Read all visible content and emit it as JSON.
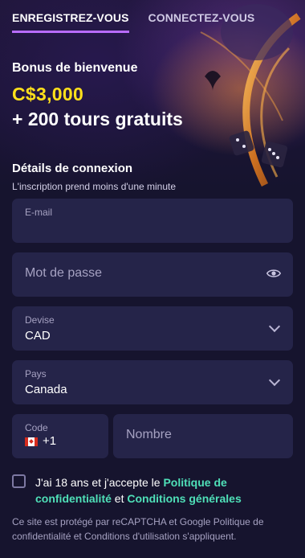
{
  "tabs": {
    "register": "ENREGISTREZ-VOUS",
    "login": "CONNECTEZ-VOUS"
  },
  "bonus": {
    "label": "Bonus de bienvenue",
    "amount": "C$3,000",
    "spins": "+ 200 tours gratuits"
  },
  "section": {
    "title": "Détails de connexion",
    "subtitle": "L'inscription prend moins d'une minute"
  },
  "form": {
    "email": {
      "label": "E-mail",
      "value": ""
    },
    "password": {
      "placeholder": "Mot de passe"
    },
    "currency": {
      "label": "Devise",
      "value": "CAD"
    },
    "country": {
      "label": "Pays",
      "value": "Canada"
    },
    "phone_code": {
      "label": "Code",
      "value": "+1",
      "flag": "canada-flag"
    },
    "phone_number": {
      "placeholder": "Nombre"
    }
  },
  "consent": {
    "prefix": "J'ai 18 ans et j'accepte le ",
    "privacy_link": "Politique de confidentialité",
    "middle": " et ",
    "terms_link": "Conditions générales"
  },
  "recaptcha_notice": "Ce site est protégé par reCAPTCHA et Google Politique de confidentialité et Conditions d'utilisation s'appliquent.",
  "colors": {
    "background": "#16142e",
    "field": "#252449",
    "accent_tab": "#b86cff",
    "bonus": "#ffe01b",
    "link": "#4fe0b8"
  }
}
